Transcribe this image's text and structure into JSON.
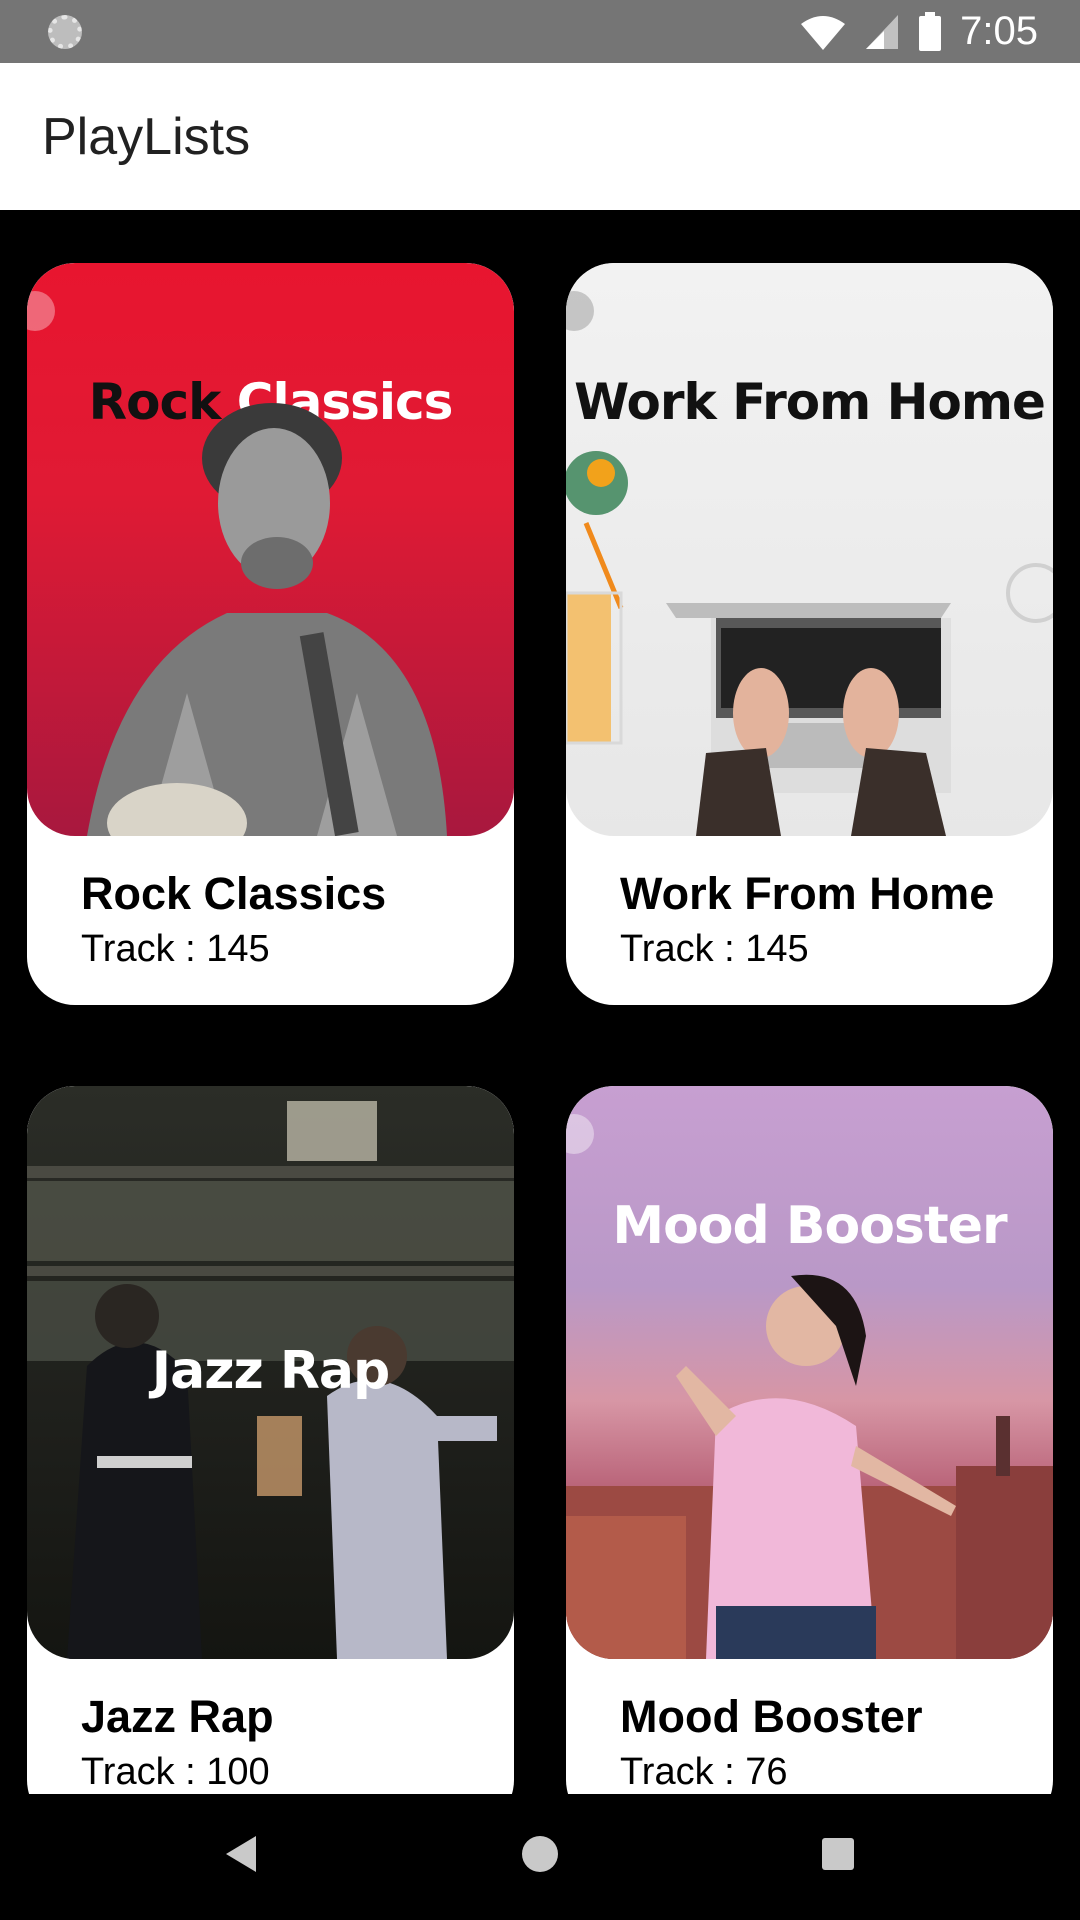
{
  "status_bar": {
    "time": "7:05",
    "icons": [
      "loading-indicator-icon",
      "wifi-icon",
      "signal-icon",
      "battery-icon"
    ]
  },
  "app_bar": {
    "title": "PlayLists"
  },
  "playlists": [
    {
      "cover_text": "Rock Classics",
      "cover_text_parts": [
        "Rock",
        "Classics"
      ],
      "title": "Rock Classics",
      "tracks": "Track : 145",
      "cover_colors": [
        "#e8152f",
        "#a8183e"
      ]
    },
    {
      "cover_text": "Work From Home",
      "title": "Work From Home",
      "tracks": "Track : 145",
      "cover_colors": [
        "#f0f0f0",
        "#dcdcdc"
      ]
    },
    {
      "cover_text": "Jazz Rap",
      "title": "Jazz Rap",
      "tracks": "Track : 100",
      "cover_colors": [
        "#2b2d27",
        "#141511"
      ]
    },
    {
      "cover_text": "Mood Booster",
      "title": "Mood Booster",
      "tracks": "Track : 76",
      "cover_colors": [
        "#c79fd1",
        "#b0546b"
      ]
    }
  ],
  "nav_bar": {
    "icons": [
      "back-icon",
      "home-icon",
      "recents-icon"
    ]
  }
}
